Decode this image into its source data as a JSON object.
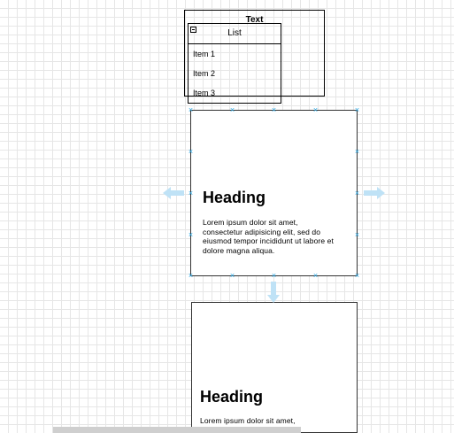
{
  "text_container": {
    "title": "Text"
  },
  "list": {
    "title": "List",
    "items": [
      "Item 1",
      "Item 2",
      "Item 3"
    ]
  },
  "cards": [
    {
      "heading": "Heading",
      "body": "Lorem ipsum dolor sit amet, consectetur adipisicing elit, sed do eiusmod tempor incididunt ut labore et dolore magna aliqua."
    },
    {
      "heading": "Heading",
      "body": "Lorem ipsum dolor sit amet,"
    }
  ],
  "colors": {
    "handle": "#29a6e3",
    "hover_arrow": "#bfe2f6",
    "grid": "#e6e6e6"
  },
  "icons": [
    "collapse-icon",
    "connection-point-icon",
    "hover-arrow-left-icon",
    "hover-arrow-right-icon",
    "hover-arrow-down-icon"
  ]
}
